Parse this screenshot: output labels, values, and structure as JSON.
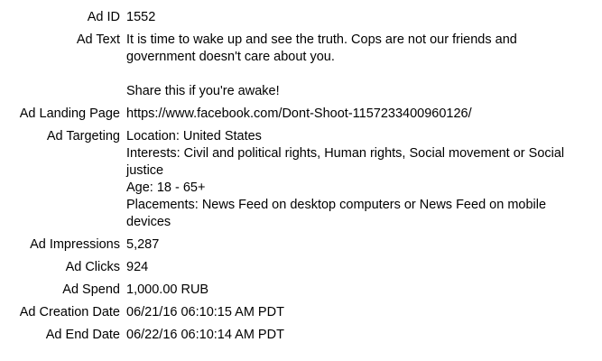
{
  "ad": {
    "fields": {
      "id": {
        "label": "Ad ID",
        "value": "1552"
      },
      "text": {
        "label": "Ad Text",
        "paragraph1": "It is time to wake up and see the truth. Cops are not our friends and government doesn't care about you.",
        "paragraph2": "Share this if you're awake!"
      },
      "landing_page": {
        "label": "Ad Landing Page",
        "value": "https://www.facebook.com/Dont-Shoot-1157233400960126/"
      },
      "targeting": {
        "label": "Ad Targeting",
        "location": "Location: United States",
        "interests": "Interests: Civil and political rights, Human rights, Social movement or Social justice",
        "age": "Age: 18 - 65+",
        "placements": "Placements: News Feed on desktop computers or News Feed on mobile devices"
      },
      "impressions": {
        "label": "Ad Impressions",
        "value": "5,287"
      },
      "clicks": {
        "label": "Ad Clicks",
        "value": "924"
      },
      "spend": {
        "label": "Ad Spend",
        "value": "1,000.00 RUB"
      },
      "creation_date": {
        "label": "Ad Creation Date",
        "value": "06/21/16 06:10:15 AM PDT"
      },
      "end_date": {
        "label": "Ad End Date",
        "value": "06/22/16 06:10:14 AM PDT"
      }
    }
  }
}
